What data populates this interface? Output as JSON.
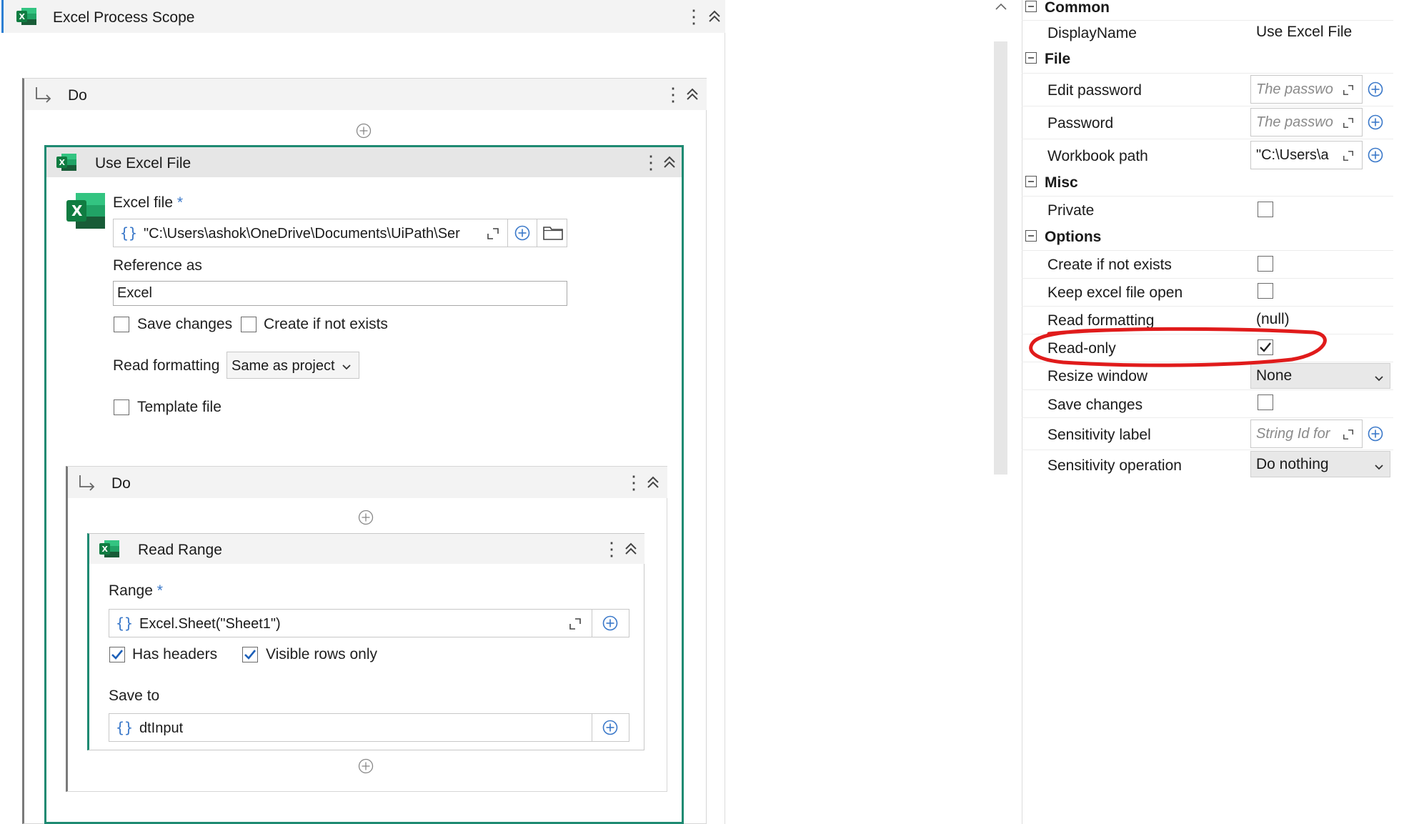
{
  "scope": {
    "title": "Excel Process Scope"
  },
  "do_outer": {
    "label": "Do"
  },
  "use_excel": {
    "title": "Use Excel File",
    "excel_file_label": "Excel file",
    "required_mark": "*",
    "excel_file_value": "\"C:\\Users\\ashok\\OneDrive\\Documents\\UiPath\\Ser",
    "reference_as_label": "Reference as",
    "reference_as_value": "Excel",
    "save_changes_label": "Save changes",
    "create_if_not_exists_label": "Create if not exists",
    "read_formatting_label": "Read formatting",
    "read_formatting_value": "Same as project",
    "template_file_label": "Template file"
  },
  "do_inner": {
    "label": "Do"
  },
  "read_range": {
    "title": "Read Range",
    "range_label": "Range",
    "required_mark": "*",
    "range_value": "Excel.Sheet(\"Sheet1\")",
    "has_headers_label": "Has headers",
    "visible_rows_label": "Visible rows only",
    "save_to_label": "Save to",
    "save_to_value": "dtInput"
  },
  "properties": {
    "common": "Common",
    "display_name_label": "DisplayName",
    "display_name_value": "Use Excel File",
    "file": "File",
    "edit_password_label": "Edit password",
    "edit_password_ph": "The passwo",
    "password_label": "Password",
    "password_ph": "The passwo",
    "workbook_path_label": "Workbook path",
    "workbook_path_value": "\"C:\\Users\\a",
    "misc": "Misc",
    "private_label": "Private",
    "options": "Options",
    "create_if_not_exists_label": "Create if not exists",
    "keep_open_label": "Keep excel file open",
    "read_formatting_label": "Read formatting",
    "read_formatting_value": "(null)",
    "read_only_label": "Read-only",
    "resize_window_label": "Resize window",
    "resize_window_value": "None",
    "save_changes_label": "Save changes",
    "sensitivity_label_label": "Sensitivity label",
    "sensitivity_label_ph": "String Id for",
    "sensitivity_operation_label": "Sensitivity operation",
    "sensitivity_operation_value": "Do nothing"
  },
  "colors": {
    "accent_teal": "#1e8a72",
    "excel_green": "#1d7a45",
    "annotation_red": "#e01b1b",
    "link_blue": "#3a78c9"
  }
}
